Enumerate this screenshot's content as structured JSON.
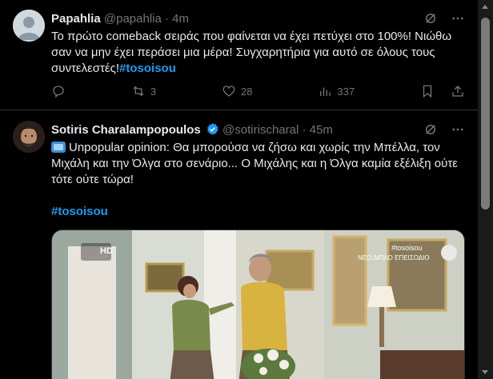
{
  "tweets": [
    {
      "name": "Papahlia",
      "handle": "@papahlia",
      "time": "· 4m",
      "text": "Το πρώτο comeback σειράς που φαίνεται να έχει πετύχει στο 100%! Νιώθω σαν να μην έχει περάσει μια μέρα! Συγχαρητήρια για αυτό σε όλους τους συντελεστές!",
      "hashtag": "#tosoisou",
      "retweets": "3",
      "likes": "28",
      "views": "337"
    },
    {
      "name": "Sotiris Charalampopoulos",
      "handle": "@sotirischaral",
      "time": "· 45m",
      "text": "Unpopular opinion: Θα μπορούσα να ζήσω και χωρίς την Μπέλλα, τον Μιχάλη και την Όλγα στο σενάριο... Ο Μιχάλης και η Όλγα καμία εξέλιξη ούτε τότε ούτε τώρα!",
      "hashtag": "#tosoisou",
      "media": {
        "hd_label": "HD",
        "hashtag_overlay": "#tosoisou",
        "episode_overlay": "ΝΕΟ ΔΙΠΛΟ ΕΠΕΙΣΟΔΙΟ"
      }
    }
  ],
  "colors": {
    "background": "#000000",
    "text": "#e7e9ea",
    "secondary": "#71767b",
    "accent": "#1d9bf0",
    "border": "#2f3336"
  }
}
